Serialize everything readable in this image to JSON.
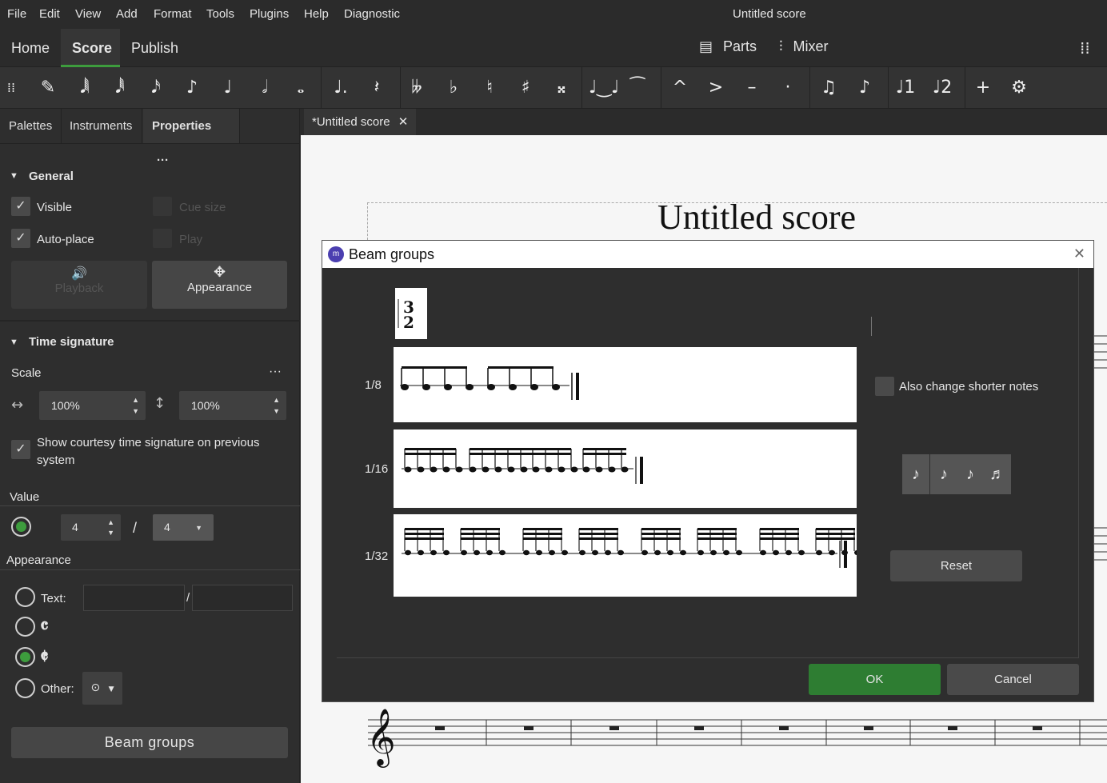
{
  "menu": [
    "File",
    "Edit",
    "View",
    "Add",
    "Format",
    "Tools",
    "Plugins",
    "Help",
    "Diagnostic"
  ],
  "window_title": "Untitled score",
  "top_tabs": {
    "home": "Home",
    "score": "Score",
    "publish": "Publish"
  },
  "top_right": {
    "parts": "Parts",
    "mixer": "Mixer"
  },
  "toolbar_icons": [
    "note-input-icon",
    "64th-note-icon",
    "32nd-note-icon",
    "16th-note-icon",
    "eighth-note-icon",
    "quarter-note-icon",
    "half-note-icon",
    "whole-note-icon",
    "dot-icon",
    "rest-icon",
    "double-flat-icon",
    "flat-icon",
    "natural-icon",
    "sharp-icon",
    "double-sharp-icon",
    "tie-icon",
    "slur-icon",
    "marcato-icon",
    "accent-icon",
    "tenuto-icon",
    "staccato-icon",
    "tuplet-icon",
    "flip-icon",
    "voice1-icon",
    "voice2-icon",
    "add-icon",
    "settings-icon"
  ],
  "panel_tabs": {
    "palettes": "Palettes",
    "instruments": "Instruments",
    "properties": "Properties"
  },
  "general": {
    "title": "General",
    "visible": "Visible",
    "cue_size": "Cue size",
    "auto_place": "Auto-place",
    "play": "Play",
    "playback": "Playback",
    "appearance": "Appearance"
  },
  "timesig": {
    "title": "Time signature",
    "scale": "Scale",
    "scale_h": "100%",
    "scale_v": "100%",
    "courtesy": "Show courtesy time signature on previous system",
    "value": "Value",
    "numerator": "4",
    "slash": "/",
    "denominator": "4",
    "appearance": "Appearance",
    "text_label": "Text:",
    "common": "𝄴",
    "cut": "𝄵",
    "other": "Other:",
    "beam_groups": "Beam groups"
  },
  "doc_tab": "*Untitled score",
  "score_title": "Untitled score",
  "dialog": {
    "title": "Beam groups",
    "rows": [
      "1/8",
      "1/16",
      "1/32"
    ],
    "also_change": "Also change shorter notes",
    "reset": "Reset",
    "ok": "OK",
    "cancel": "Cancel",
    "ts_glyph": "3\n2"
  },
  "colors": {
    "accent": "#3d9c3d",
    "ok_button": "#2e7d32"
  }
}
